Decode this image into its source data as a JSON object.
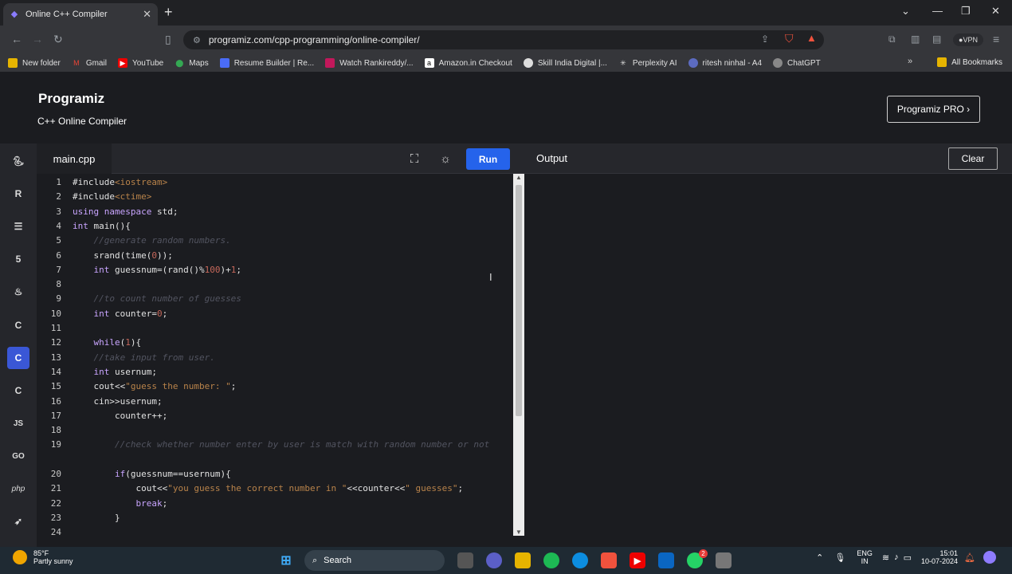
{
  "browser": {
    "tab_title": "Online C++ Compiler",
    "url": "programiz.com/cpp-programming/online-compiler/",
    "vpn_label": "VPN",
    "bookmarks": [
      "New folder",
      "Gmail",
      "YouTube",
      "Maps",
      "Resume Builder | Re...",
      "Watch Rankireddy/...",
      "Amazon.in Checkout",
      "Skill India Digital |...",
      "Perplexity AI",
      "ritesh ninhal - A4",
      "ChatGPT"
    ],
    "all_bookmarks": "All Bookmarks"
  },
  "header": {
    "logo": "Programiz",
    "subtitle": "C++ Online Compiler",
    "pro_button": "Programiz PRO ›"
  },
  "sidebar": {
    "items": [
      "python-icon",
      "r-icon",
      "sql-icon",
      "html-icon",
      "java-icon",
      "c-icon",
      "cpp-icon",
      "csharp-icon",
      "js-icon",
      "go-icon",
      "php-icon",
      "swift-icon"
    ],
    "labels": [
      "JS",
      "GO",
      "php"
    ],
    "active": "cpp-icon"
  },
  "editor": {
    "filename": "main.cpp",
    "run_label": "Run",
    "lines": [
      {
        "n": "1",
        "t": "#include<iostream>"
      },
      {
        "n": "2",
        "t": "#include<ctime>"
      },
      {
        "n": "3",
        "t": "using namespace std;"
      },
      {
        "n": "4",
        "t": "int main(){"
      },
      {
        "n": "5",
        "t": "    //generate random numbers."
      },
      {
        "n": "6",
        "t": "    srand(time(0));"
      },
      {
        "n": "7",
        "t": "    int guessnum=(rand()%100)+1;"
      },
      {
        "n": "8",
        "t": ""
      },
      {
        "n": "9",
        "t": "    //to count number of guesses"
      },
      {
        "n": "10",
        "t": "    int counter=0;"
      },
      {
        "n": "11",
        "t": ""
      },
      {
        "n": "12",
        "t": "    while(1){"
      },
      {
        "n": "13",
        "t": "    //take input from user."
      },
      {
        "n": "14",
        "t": "    int usernum;"
      },
      {
        "n": "15",
        "t": "    cout<<\"guess the number: \";"
      },
      {
        "n": "16",
        "t": "    cin>>usernum;"
      },
      {
        "n": "17",
        "t": "        counter++;"
      },
      {
        "n": "18",
        "t": ""
      },
      {
        "n": "19",
        "t": "        //check whether number enter by user is match with random number or not"
      },
      {
        "n": "20",
        "t": "        if(guessnum==usernum){"
      },
      {
        "n": "21",
        "t": "            cout<<\"you guess the correct number in \"<<counter<<\" guesses\";"
      },
      {
        "n": "22",
        "t": "            break;"
      },
      {
        "n": "23",
        "t": "        }"
      },
      {
        "n": "24",
        "t": ""
      }
    ]
  },
  "output": {
    "label": "Output",
    "clear_label": "Clear"
  },
  "taskbar": {
    "temperature": "85°F",
    "weather": "Partly sunny",
    "search_placeholder": "Search",
    "lang1": "ENG",
    "lang2": "IN",
    "time": "15:01",
    "date": "10-07-2024",
    "whatsapp_badge": "2"
  }
}
